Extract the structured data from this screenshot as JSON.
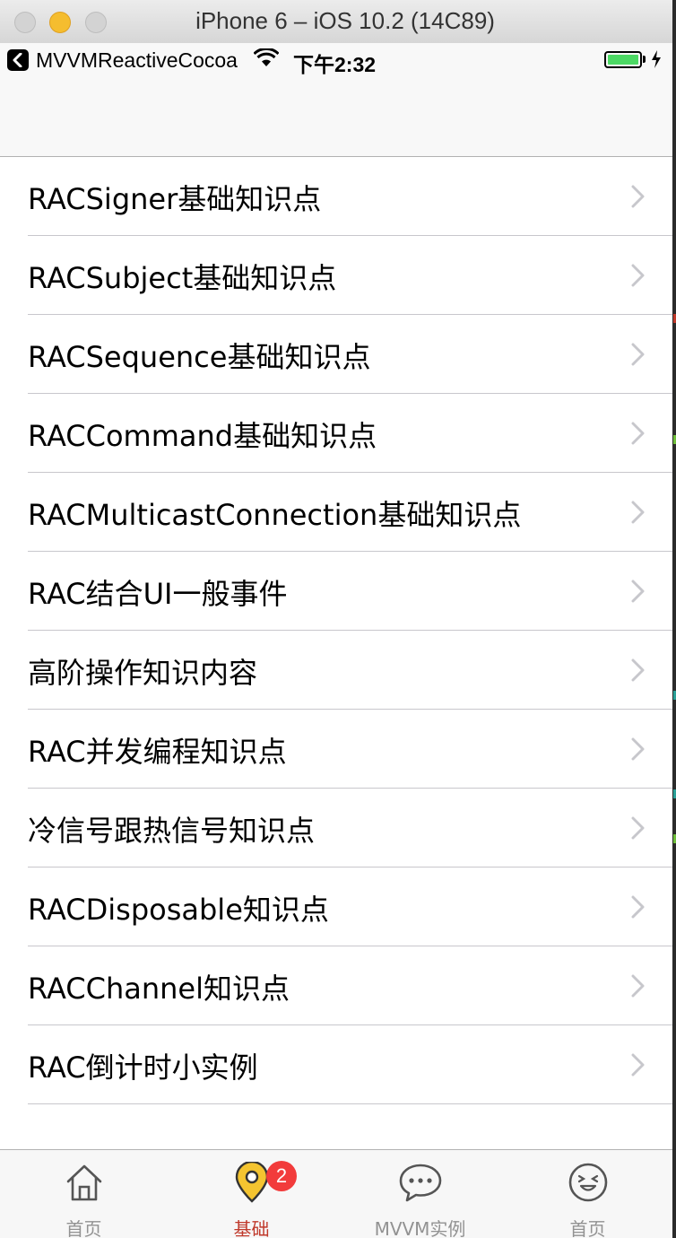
{
  "window": {
    "title": "iPhone 6 – iOS 10.2 (14C89)"
  },
  "status_bar": {
    "back_app": "MVVMReactiveCocoa",
    "time": "下午2:32",
    "battery_color": "#4cd964",
    "icons": [
      "back-arrow-icon",
      "wifi-icon",
      "battery-icon",
      "charging-bolt-icon"
    ]
  },
  "list": {
    "items": [
      {
        "label": "RACSigner基础知识点"
      },
      {
        "label": "RACSubject基础知识点"
      },
      {
        "label": "RACSequence基础知识点"
      },
      {
        "label": "RACCommand基础知识点"
      },
      {
        "label": "RACMulticastConnection基础知识点"
      },
      {
        "label": "RAC结合UI一般事件"
      },
      {
        "label": "高阶操作知识内容"
      },
      {
        "label": "RAC并发编程知识点"
      },
      {
        "label": "冷信号跟热信号知识点"
      },
      {
        "label": "RACDisposable知识点"
      },
      {
        "label": "RACChannel知识点"
      },
      {
        "label": "RAC倒计时小实例"
      }
    ],
    "accessory_icon": "chevron-right-icon"
  },
  "tab_bar": {
    "tabs": [
      {
        "label": "首页",
        "icon": "home-icon",
        "active": false
      },
      {
        "label": "基础",
        "icon": "location-pin-icon",
        "active": true,
        "badge": "2"
      },
      {
        "label": "MVVM实例",
        "icon": "chat-bubble-icon",
        "active": false
      },
      {
        "label": "首页",
        "icon": "smiley-face-icon",
        "active": false
      }
    ],
    "active_color": "#c0392b",
    "inactive_color": "#929292",
    "badge_color": "#f23b3b"
  }
}
